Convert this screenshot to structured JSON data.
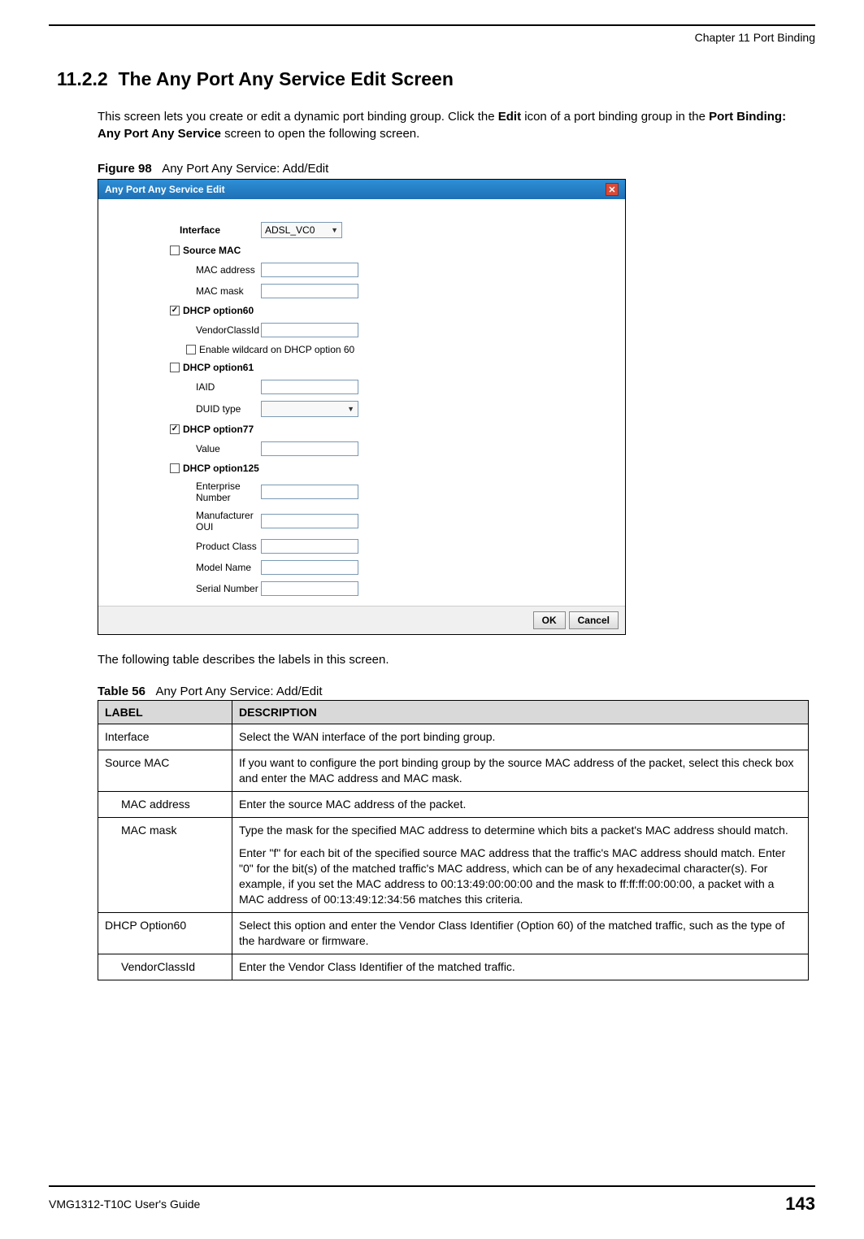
{
  "chapter": "Chapter 11 Port Binding",
  "section_num": "11.2.2",
  "section_title": "The Any Port Any Service Edit Screen",
  "intro": {
    "t1": "This screen lets you create or edit a dynamic port binding group. Click the ",
    "t2": "Edit",
    "t3": " icon of a port binding group in the ",
    "t4": "Port Binding: Any Port Any Service",
    "t5": " screen to open the following screen."
  },
  "figure": {
    "label": "Figure 98",
    "title": "Any Port Any Service: Add/Edit"
  },
  "screenshot": {
    "title": "Any Port Any Service Edit",
    "interface_label": "Interface",
    "interface_value": "ADSL_VC0",
    "source_mac": "Source MAC",
    "mac_address": "MAC address",
    "mac_mask": "MAC mask",
    "dhcp60": "DHCP option60",
    "vendorclassid": "VendorClassId",
    "enable_wildcard": "Enable wildcard on DHCP option 60",
    "dhcp61": "DHCP option61",
    "iaid": "IAID",
    "duid_type": "DUID type",
    "dhcp77": "DHCP option77",
    "value": "Value",
    "dhcp125": "DHCP option125",
    "enterprise_number": "Enterprise Number",
    "manufacturer_oui": "Manufacturer OUI",
    "product_class": "Product Class",
    "model_name": "Model Name",
    "serial_number": "Serial Number",
    "ok": "OK",
    "cancel": "Cancel"
  },
  "post_figure": "The following table describes the labels in this screen.",
  "table": {
    "label": "Table 56",
    "title": "Any Port Any Service: Add/Edit",
    "header_label": "LABEL",
    "header_desc": "DESCRIPTION",
    "rows": [
      {
        "label": "Interface",
        "desc": "Select the WAN interface of the port binding group."
      },
      {
        "label": "Source MAC",
        "desc": "If you want to configure the port binding group by the source MAC address of the packet, select this check box and enter the MAC address and MAC mask."
      },
      {
        "label": "MAC address",
        "desc": "Enter the source MAC address of the packet.",
        "indent": true
      },
      {
        "label": "MAC mask",
        "desc_p1": "Type the mask for the specified MAC address to determine which bits a packet's MAC address should match.",
        "desc_p2": "Enter \"f\" for each bit of the specified source MAC address that the traffic's MAC address should match. Enter \"0\" for the bit(s) of the matched traffic's MAC address, which can be of any hexadecimal character(s). For example, if you set the MAC address to 00:13:49:00:00:00 and the mask to ff:ff:ff:00:00:00, a packet with a MAC address of 00:13:49:12:34:56 matches this criteria.",
        "indent": true
      },
      {
        "label": "DHCP Option60",
        "desc": "Select this option and enter the Vendor Class Identifier (Option 60) of the matched traffic, such as the type of the hardware or firmware."
      },
      {
        "label": "VendorClassId",
        "desc": "Enter the Vendor Class Identifier of the matched traffic.",
        "indent": true
      }
    ]
  },
  "footer": {
    "guide": "VMG1312-T10C User's Guide",
    "page": "143"
  }
}
